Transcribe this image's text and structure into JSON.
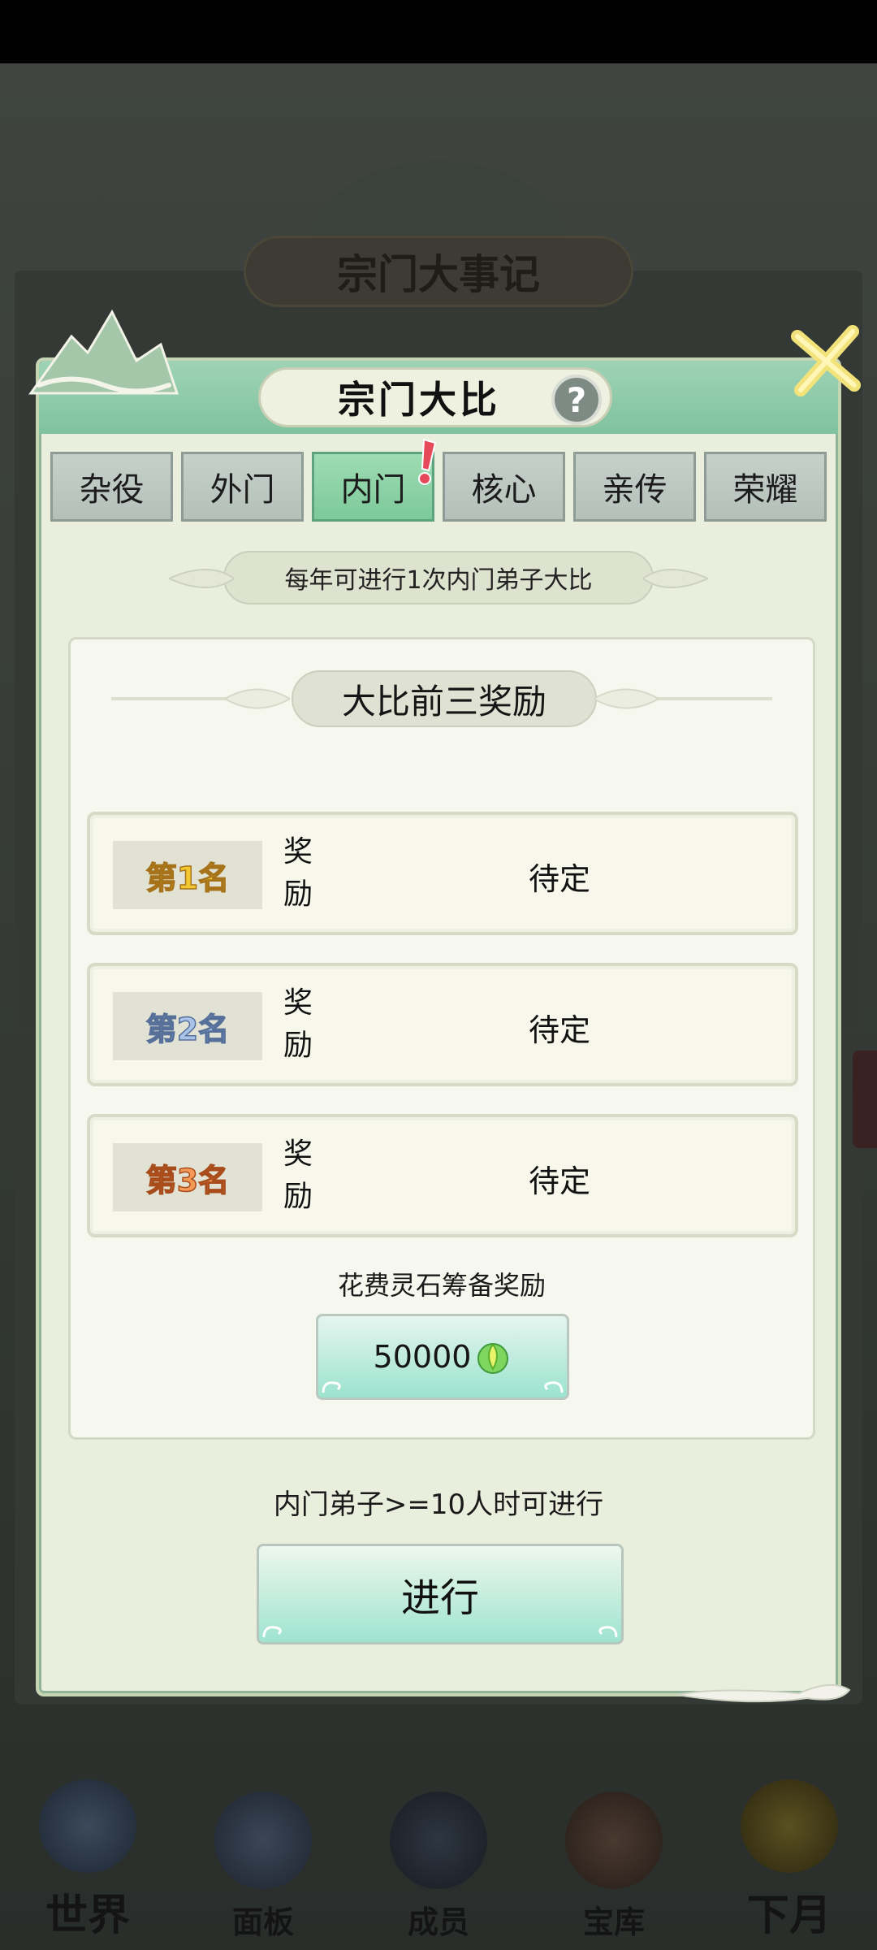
{
  "background": {
    "banner_title": "宗门大事记"
  },
  "modal": {
    "title": "宗门大比",
    "help_glyph": "?",
    "tabs": [
      {
        "label": "杂役",
        "active": false
      },
      {
        "label": "外门",
        "active": false
      },
      {
        "label": "内门",
        "active": true,
        "badge": true
      },
      {
        "label": "核心",
        "active": false
      },
      {
        "label": "亲传",
        "active": false
      },
      {
        "label": "荣耀",
        "active": false
      }
    ],
    "info_text": "每年可进行1次内门弟子大比",
    "card": {
      "title": "大比前三奖励",
      "rewards": [
        {
          "rank": "第1名",
          "label": "奖励",
          "value": "待定"
        },
        {
          "rank": "第2名",
          "label": "奖励",
          "value": "待定"
        },
        {
          "rank": "第3名",
          "label": "奖励",
          "value": "待定"
        }
      ],
      "cost_label": "花费灵石筹备奖励",
      "cost_value": "50000"
    },
    "condition_text": "内门弟子>=10人时可进行",
    "go_button": "进行"
  },
  "bottom_nav": [
    {
      "label": "世界",
      "icon": "world-icon"
    },
    {
      "label": "面板",
      "icon": "panel-icon"
    },
    {
      "label": "成员",
      "icon": "members-icon"
    },
    {
      "label": "宝库",
      "icon": "treasury-icon"
    },
    {
      "label": "下月",
      "icon": "next-month-icon"
    }
  ],
  "colors": {
    "accent_green": "#7fc29e",
    "modal_bg": "#e9eedd",
    "rank1": "#f3c72f",
    "rank2": "#a9c3e8",
    "rank3": "#f59a56"
  }
}
